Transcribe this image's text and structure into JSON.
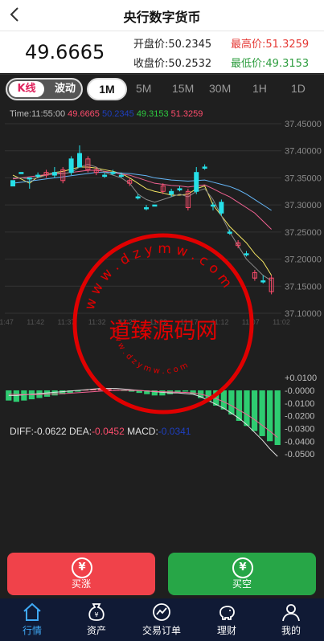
{
  "header": {
    "title": "央行数字货币"
  },
  "price": {
    "current": "49.6665",
    "open_label": "开盘价:",
    "open_value": "50.2345",
    "high_label": "最高价:",
    "high_value": "51.3259",
    "close_label": "收盘价:",
    "close_value": "50.2532",
    "low_label": "最低价:",
    "low_value": "49.3153"
  },
  "tabs": {
    "kline_label": "K线",
    "wave_label": "波动",
    "timeframes": [
      "1M",
      "5M",
      "15M",
      "30M",
      "1H",
      "1D"
    ],
    "active": "1M"
  },
  "chart_legend": {
    "time": "Time:11:55:00",
    "v1": "49.6665",
    "v2": "50.2345",
    "v3": "49.3153",
    "v4": "51.3259"
  },
  "macd_legend": {
    "diff": "DIFF:-0.0622",
    "dea_label": "DEA:",
    "dea_value": "-0.0452",
    "macd_label": "MACD:",
    "macd_value": "-0.0341"
  },
  "chart_data": [
    {
      "type": "candlestick",
      "y_ticks": [
        "37.45000",
        "37.40000",
        "37.35000",
        "37.30000",
        "37.25000",
        "37.20000",
        "37.15000",
        "37.10000"
      ],
      "ylim": [
        37.1,
        37.45
      ],
      "x_ticks": [
        "11:47",
        "11:42",
        "11:37",
        "11:32",
        "11:27",
        "11:22",
        "11:17",
        "11:12",
        "11:07",
        "11:02"
      ],
      "candles": [
        {
          "o": 37.335,
          "c": 37.345,
          "h": 37.345,
          "l": 37.335
        },
        {
          "o": 37.36,
          "c": 37.36,
          "h": 37.36,
          "l": 37.36
        },
        {
          "o": 37.35,
          "c": 37.35,
          "h": 37.35,
          "l": 37.33
        },
        {
          "o": 37.355,
          "c": 37.355,
          "h": 37.36,
          "l": 37.35
        },
        {
          "o": 37.36,
          "c": 37.355,
          "h": 37.365,
          "l": 37.35
        },
        {
          "o": 37.355,
          "c": 37.36,
          "h": 37.37,
          "l": 37.35
        },
        {
          "o": 37.365,
          "c": 37.345,
          "h": 37.37,
          "l": 37.34
        },
        {
          "o": 37.36,
          "c": 37.385,
          "h": 37.39,
          "l": 37.355
        },
        {
          "o": 37.37,
          "c": 37.395,
          "h": 37.41,
          "l": 37.37
        },
        {
          "o": 37.385,
          "c": 37.365,
          "h": 37.39,
          "l": 37.36
        },
        {
          "o": 37.365,
          "c": 37.36,
          "h": 37.37,
          "l": 37.355
        },
        {
          "o": 37.355,
          "c": 37.355,
          "h": 37.36,
          "l": 37.35
        },
        {
          "o": 37.36,
          "c": 37.36,
          "h": 37.365,
          "l": 37.355
        },
        {
          "o": 37.355,
          "c": 37.355,
          "h": 37.36,
          "l": 37.35
        },
        {
          "o": 37.345,
          "c": 37.34,
          "h": 37.35,
          "l": 37.335
        },
        {
          "o": 37.315,
          "c": 37.315,
          "h": 37.32,
          "l": 37.31
        },
        {
          "o": 37.295,
          "c": 37.295,
          "h": 37.3,
          "l": 37.29
        },
        {
          "o": 37.3,
          "c": 37.3,
          "h": 37.3,
          "l": 37.3
        },
        {
          "o": 37.335,
          "c": 37.325,
          "h": 37.34,
          "l": 37.32
        },
        {
          "o": 37.32,
          "c": 37.325,
          "h": 37.33,
          "l": 37.315
        },
        {
          "o": 37.33,
          "c": 37.33,
          "h": 37.335,
          "l": 37.325
        },
        {
          "o": 37.325,
          "c": 37.295,
          "h": 37.33,
          "l": 37.29
        },
        {
          "o": 37.325,
          "c": 37.36,
          "h": 37.37,
          "l": 37.32
        },
        {
          "o": 37.37,
          "c": 37.37,
          "h": 37.375,
          "l": 37.365
        },
        {
          "o": 37.3,
          "c": 37.3,
          "h": 37.305,
          "l": 37.29
        },
        {
          "o": 37.285,
          "c": 37.305,
          "h": 37.31,
          "l": 37.28
        },
        {
          "o": 37.25,
          "c": 37.25,
          "h": 37.255,
          "l": 37.245
        },
        {
          "o": 37.23,
          "c": 37.225,
          "h": 37.235,
          "l": 37.22
        },
        {
          "o": 37.21,
          "c": 37.21,
          "h": 37.215,
          "l": 37.205
        },
        {
          "o": 37.175,
          "c": 37.165,
          "h": 37.18,
          "l": 37.16
        },
        {
          "o": 37.16,
          "c": 37.16,
          "h": 37.17,
          "l": 37.155
        },
        {
          "o": 37.165,
          "c": 37.14,
          "h": 37.17,
          "l": 37.135
        }
      ],
      "series": [
        {
          "color": "#f5e663",
          "values": [
            37.355,
            37.348,
            37.34,
            37.352,
            37.356,
            37.36,
            37.362,
            37.366,
            37.37,
            37.37,
            37.368,
            37.365,
            37.362,
            37.358,
            37.35,
            37.34,
            37.33,
            37.325,
            37.322,
            37.318,
            37.318,
            37.32,
            37.33,
            37.335,
            37.3,
            37.28,
            37.26,
            37.245,
            37.23,
            37.21,
            37.195,
            37.17
          ]
        },
        {
          "color": "#f06292",
          "values": [
            37.348,
            37.35,
            37.352,
            37.354,
            37.356,
            37.357,
            37.358,
            37.36,
            37.362,
            37.364,
            37.364,
            37.362,
            37.36,
            37.357,
            37.355,
            37.35,
            37.345,
            37.34,
            37.338,
            37.336,
            37.335,
            37.333,
            37.335,
            37.337,
            37.33,
            37.322,
            37.315,
            37.305,
            37.295,
            37.285,
            37.27,
            37.255
          ]
        },
        {
          "color": "#64b5f6",
          "values": [
            37.34,
            37.342,
            37.344,
            37.346,
            37.348,
            37.35,
            37.352,
            37.354,
            37.356,
            37.358,
            37.36,
            37.36,
            37.36,
            37.359,
            37.358,
            37.356,
            37.354,
            37.35,
            37.348,
            37.346,
            37.345,
            37.344,
            37.345,
            37.346,
            37.342,
            37.338,
            37.334,
            37.328,
            37.32,
            37.31,
            37.3,
            37.29
          ]
        },
        {
          "color": "#8a8a8a",
          "values": [
            37.35,
            37.35,
            37.348,
            37.35,
            37.355,
            37.36,
            37.358,
            37.36,
            37.37,
            37.375,
            37.37,
            37.36,
            37.355,
            37.35,
            37.34,
            37.32,
            37.31,
            37.305,
            37.31,
            37.315,
            37.32,
            37.315,
            37.325,
            37.33,
            37.31,
            37.28,
            37.25,
            37.225,
            37.2,
            37.185,
            37.17,
            37.16
          ]
        }
      ]
    },
    {
      "type": "bar",
      "name_hint": "MACD",
      "y_ticks": [
        "+0.0100",
        "-0.0000",
        "-0.0100",
        "-0.0200",
        "-0.0300",
        "-0.0400",
        "-0.0500"
      ],
      "ylim": [
        -0.055,
        0.012
      ],
      "values": [
        -0.008,
        -0.009,
        -0.008,
        -0.007,
        -0.006,
        -0.005,
        -0.004,
        -0.003,
        -0.002,
        -0.001,
        0.0005,
        0.001,
        0.0015,
        0.001,
        0.0005,
        -0.0005,
        -0.001,
        -0.002,
        -0.003,
        -0.004,
        -0.004,
        -0.003,
        -0.002,
        -0.001,
        -0.003,
        -0.006,
        -0.009,
        -0.012,
        -0.015,
        -0.019,
        -0.024,
        -0.028,
        -0.032,
        -0.036,
        -0.04,
        -0.043
      ],
      "series": [
        {
          "color": "#e0e0e0",
          "values": [
            -0.004,
            -0.004,
            -0.0035,
            -0.003,
            -0.0025,
            -0.002,
            -0.0015,
            -0.001,
            -0.0005,
            0.0,
            0.0005,
            0.001,
            0.0015,
            0.0015,
            0.0015,
            0.001,
            0.0005,
            0.0,
            -0.0005,
            -0.001,
            -0.0015,
            -0.002,
            -0.002,
            -0.0025,
            -0.003,
            -0.005,
            -0.008,
            -0.011,
            -0.014,
            -0.018,
            -0.022,
            -0.027,
            -0.033,
            -0.039,
            -0.046,
            -0.052
          ]
        },
        {
          "color": "#f06292",
          "values": [
            -0.003,
            -0.0032,
            -0.0033,
            -0.0033,
            -0.0032,
            -0.003,
            -0.0028,
            -0.0025,
            -0.0022,
            -0.0018,
            -0.0014,
            -0.001,
            -0.0006,
            -0.0003,
            0.0,
            0.0,
            0.0,
            -0.0002,
            -0.0005,
            -0.0008,
            -0.001,
            -0.0012,
            -0.0014,
            -0.0016,
            -0.002,
            -0.003,
            -0.0045,
            -0.0065,
            -0.009,
            -0.012,
            -0.0155,
            -0.019,
            -0.023,
            -0.0275,
            -0.032,
            -0.037
          ]
        }
      ]
    }
  ],
  "buttons": {
    "buy_up_icon": "¥",
    "buy_up": "买涨",
    "buy_down_icon": "¥",
    "buy_down": "买空"
  },
  "nav": [
    {
      "label": "行情",
      "icon": "home-icon",
      "active": true
    },
    {
      "label": "资产",
      "icon": "money-bag-icon",
      "active": false
    },
    {
      "label": "交易订单",
      "icon": "chart-circle-icon",
      "active": false
    },
    {
      "label": "理财",
      "icon": "piggy-bank-icon",
      "active": false
    },
    {
      "label": "我的",
      "icon": "user-icon",
      "active": false
    }
  ],
  "watermark": {
    "center_text": "道臻源码网",
    "ring_text": "w w w . d z y m w . c o m",
    "ring_text_small": "w w w . d z y m w . c o m"
  },
  "colors": {
    "up": "#f0424a",
    "down": "#27a647",
    "cyan_candle": "#26e0e8",
    "red_candle": "#ff4d6d",
    "accent_blue": "#3fa9f5",
    "watermark_red": "#e00000"
  }
}
